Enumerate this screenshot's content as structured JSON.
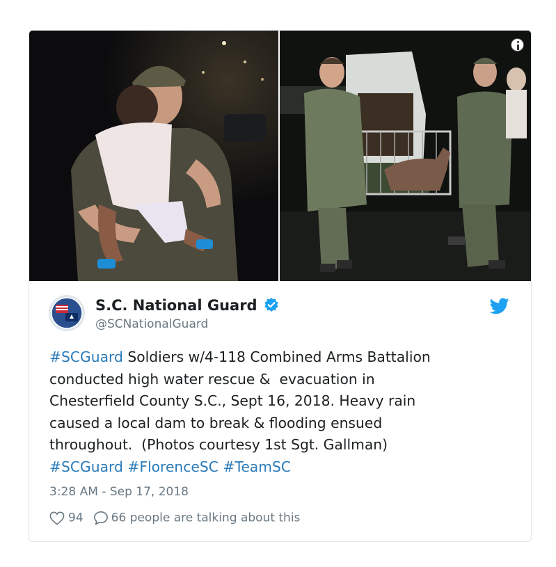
{
  "tweet": {
    "author_name": "S.C. National Guard",
    "handle": "@SCNationalGuard",
    "text_parts": [
      {
        "text": "#SCGuard",
        "tag": true
      },
      {
        "text": " Soldiers w/4-118 Combined Arms Battalion\nconducted high water rescue &  evacuation in\nChesterfield County S.C., Sept 16, 2018. Heavy rain\ncaused a local dam to break & flooding ensued\nthroughout.  (Photos courtesy 1st Sgt. Gallman)\n",
        "tag": false
      },
      {
        "text": "#SCGuard",
        "tag": true
      },
      {
        "text": " ",
        "tag": false
      },
      {
        "text": "#FlorenceSC",
        "tag": true
      },
      {
        "text": " ",
        "tag": false
      },
      {
        "text": "#TeamSC",
        "tag": true
      }
    ],
    "timestamp": "3:28 AM - Sep 17, 2018",
    "likes": "94",
    "talking": "66 people are talking about this"
  },
  "media": {
    "left_photo": "soldier-holding-child-photo",
    "right_photo": "soldiers-with-dog-crate-photo"
  },
  "icons": {
    "verified": "verified-badge-icon",
    "brand": "twitter-bird-icon",
    "info": "info-icon",
    "like": "heart-icon",
    "reply": "speech-bubble-icon"
  },
  "colors": {
    "link": "#2b7bb9",
    "verified": "#1da1f2",
    "brand": "#1da1f2",
    "muted": "#697882",
    "text": "#1c2022"
  }
}
